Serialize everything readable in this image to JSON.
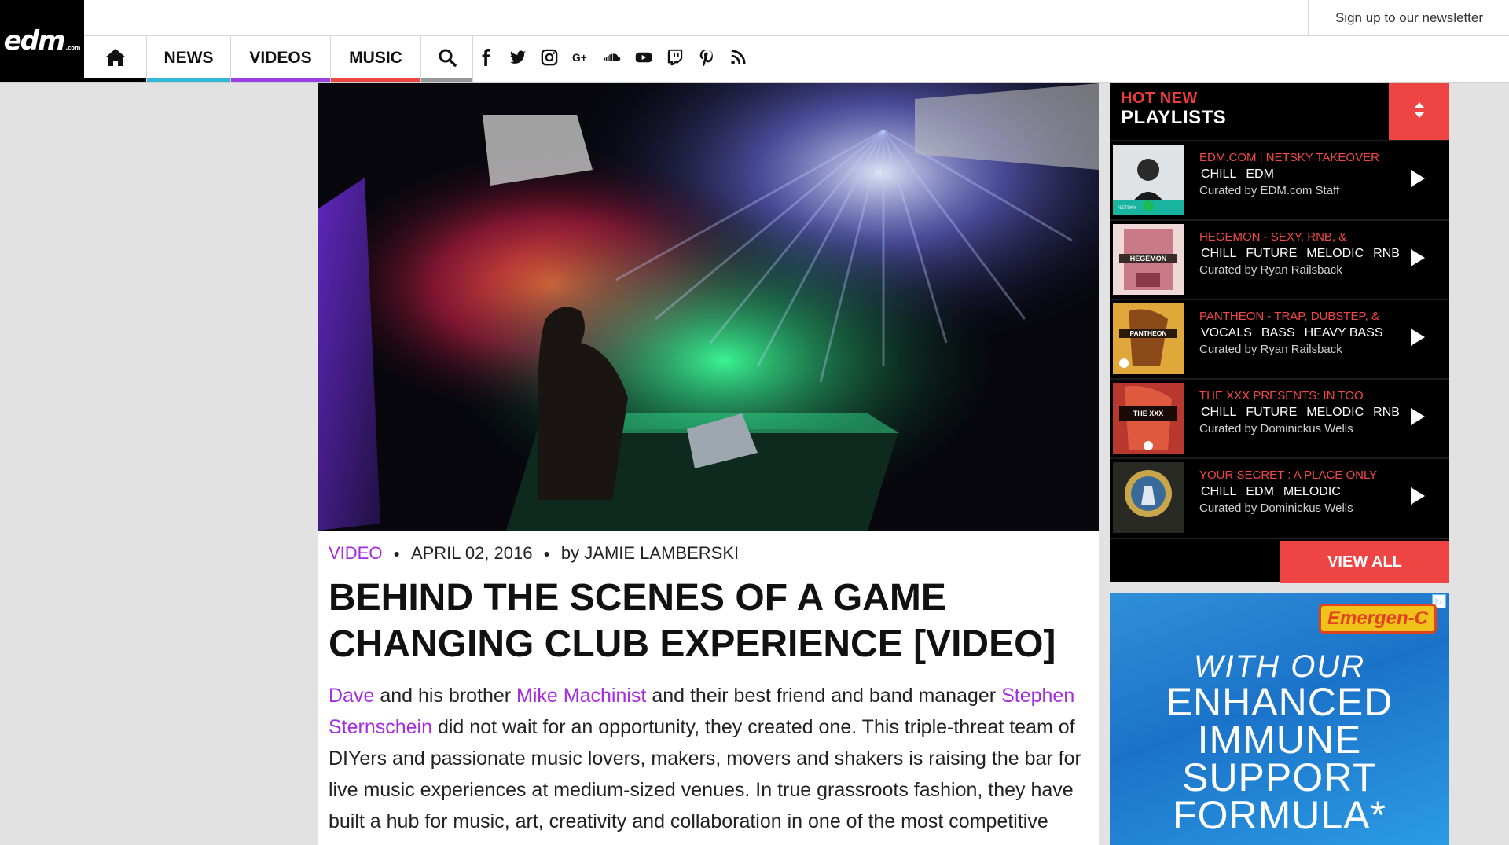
{
  "header": {
    "logo_text": "edm",
    "logo_suffix": ".com",
    "newsletter_label": "Sign up to our newsletter",
    "nav": [
      {
        "label": "NEWS",
        "color": "#2fb9d4"
      },
      {
        "label": "VIDEOS",
        "color": "#9b3fe0"
      },
      {
        "label": "MUSIC",
        "color": "#ee4444"
      }
    ],
    "nav_colors": {
      "home": "#000000",
      "search": "#999999"
    },
    "social_icons": [
      "facebook-icon",
      "twitter-icon",
      "instagram-icon",
      "google-plus-icon",
      "soundcloud-icon",
      "youtube-icon",
      "twitch-icon",
      "pinterest-icon",
      "rss-icon"
    ]
  },
  "article": {
    "category": "VIDEO",
    "date": "APRIL 02, 2016",
    "byline": "by JAMIE LAMBERSKI",
    "title": "BEHIND THE SCENES OF A GAME CHANGING CLUB EXPERIENCE [VIDEO]",
    "body": {
      "link1": "Dave",
      "t1": " and his brother ",
      "link2": "Mike Machinist",
      "t2": " and their best friend and band manager ",
      "link3": "Stephen Sternschein",
      "t3": " did not wait for an opportunity, they created one. This triple-threat team of DIYers and passionate music lovers, makers, movers and shakers is raising the bar for live music experiences at medium-sized venues. In true grassroots fashion, they have built a hub for music, art, creativity and collaboration in one of the most competitive"
    },
    "accent_color": "#a62bdf"
  },
  "playlists": {
    "hot_label": "HOT NEW",
    "title": "PLAYLISTS",
    "view_all": "VIEW ALL",
    "accent_color": "#ee4444",
    "items": [
      {
        "name": "EDM.COM | NETSKY TAKEOVER",
        "tags": [
          "CHILL",
          "EDM"
        ],
        "curator": "Curated by EDM.com Staff"
      },
      {
        "name": "HEGEMON - SEXY, RNB, &",
        "tags": [
          "CHILL",
          "FUTURE",
          "MELODIC",
          "RNB"
        ],
        "curator": "Curated by Ryan Railsback"
      },
      {
        "name": "PANTHEON - TRAP, DUBSTEP, &",
        "tags": [
          "VOCALS",
          "BASS",
          "HEAVY BASS"
        ],
        "curator": "Curated by Ryan Railsback"
      },
      {
        "name": "THE XXX PRESENTS: IN TOO",
        "tags": [
          "CHILL",
          "FUTURE",
          "MELODIC",
          "RNB"
        ],
        "curator": "Curated by Dominickus Wells"
      },
      {
        "name": "YOUR SECRET : A PLACE ONLY",
        "tags": [
          "CHILL",
          "EDM",
          "MELODIC"
        ],
        "curator": "Curated by Dominickus Wells"
      }
    ],
    "thumbs": [
      {
        "label": "NETSKY"
      },
      {
        "label": "HEGEMON"
      },
      {
        "label": "PANTHEON"
      },
      {
        "label": "THE XXX"
      },
      {
        "label": ""
      }
    ]
  },
  "ad": {
    "brand": "Emergen-C",
    "line1": "WITH OUR",
    "line2": "ENHANCED",
    "line3": "IMMUNE",
    "line4": "SUPPORT",
    "line5": "FORMULA*"
  }
}
